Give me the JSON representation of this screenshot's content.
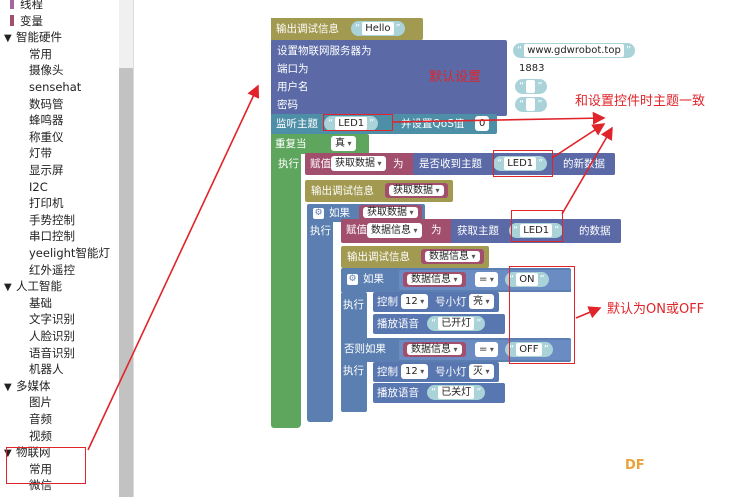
{
  "sidebar": {
    "items": [
      {
        "label": "线程",
        "kind": "sub",
        "color": "#a5659f"
      },
      {
        "label": "变量",
        "kind": "sub",
        "color": "#a24f6e"
      },
      {
        "label": "智能硬件",
        "kind": "cat"
      },
      {
        "label": "常用",
        "kind": "sub"
      },
      {
        "label": "摄像头",
        "kind": "sub"
      },
      {
        "label": "sensehat",
        "kind": "sub"
      },
      {
        "label": "数码管",
        "kind": "sub"
      },
      {
        "label": "蜂鸣器",
        "kind": "sub"
      },
      {
        "label": "称重仪",
        "kind": "sub"
      },
      {
        "label": "灯带",
        "kind": "sub"
      },
      {
        "label": "显示屏",
        "kind": "sub"
      },
      {
        "label": "I2C",
        "kind": "sub"
      },
      {
        "label": "打印机",
        "kind": "sub"
      },
      {
        "label": "手势控制",
        "kind": "sub"
      },
      {
        "label": "串口控制",
        "kind": "sub"
      },
      {
        "label": "yeelight智能灯",
        "kind": "sub"
      },
      {
        "label": "红外遥控",
        "kind": "sub"
      },
      {
        "label": "人工智能",
        "kind": "cat"
      },
      {
        "label": "基础",
        "kind": "sub"
      },
      {
        "label": "文字识别",
        "kind": "sub"
      },
      {
        "label": "人脸识别",
        "kind": "sub"
      },
      {
        "label": "语音识别",
        "kind": "sub"
      },
      {
        "label": "机器人",
        "kind": "sub"
      },
      {
        "label": "多媒体",
        "kind": "cat"
      },
      {
        "label": "图片",
        "kind": "sub"
      },
      {
        "label": "音频",
        "kind": "sub"
      },
      {
        "label": "视频",
        "kind": "sub"
      },
      {
        "label": "物联网",
        "kind": "cat"
      },
      {
        "label": "常用",
        "kind": "sub"
      },
      {
        "label": "微信",
        "kind": "sub"
      }
    ],
    "triangle": "▼"
  },
  "blocks": {
    "debug1_label": "输出调试信息",
    "debug1_value": "Hello",
    "server_label": "设置物联网服务器为",
    "server_value": "www.gdwrobot.top",
    "port_label": "端口为",
    "port_value": "1883",
    "user_label": "用户名",
    "pass_label": "密码",
    "quote_open": "“",
    "quote_close": "”",
    "subscribe_label": "监听主题",
    "subscribe_topic": "LED1",
    "qos_label": "并设置QoS值",
    "qos_value": "0",
    "repeat_label": "重复当",
    "repeat_cond": "真",
    "exec": "执行",
    "assign_label": "赋值",
    "var_get": "获取数据",
    "to_label": "为",
    "check_label": "是否收到主题",
    "check_topic": "LED1",
    "new_data_label": "的新数据",
    "debug2_label": "输出调试信息",
    "debug2_value": "获取数据",
    "if_label": "如果",
    "if_var": "获取数据",
    "assign2_label": "赋值",
    "var_msg": "数据信息",
    "to2_label": "为",
    "read_label": "获取主题",
    "read_topic": "LED1",
    "data_label": "的数据",
    "debug3_label": "输出调试信息",
    "debug3_value": "数据信息",
    "if2_label": "如果",
    "cmp_var": "数据信息",
    "cmp_op": "=",
    "cmp_on": "ON",
    "control_label": "控制",
    "lamp_num": "12",
    "lamp_label": "号小灯",
    "lamp_on": "亮",
    "speak_label": "播放语音",
    "speak_on": "已开灯",
    "elif_label": "否则如果",
    "cmp_var2": "数据信息",
    "cmp_op2": "=",
    "cmp_off": "OFF",
    "control2_label": "控制",
    "lamp_num2": "12",
    "lamp_label2": "号小灯",
    "lamp_off": "灭",
    "speak2_label": "播放语音",
    "speak_off": "已关灯"
  },
  "annotations": {
    "default_settings": "默认设置",
    "same_topic": "和设置控件时主题一致",
    "default_on_off": "默认为ON或OFF"
  },
  "watermark": "DF",
  "colors": {
    "annotation": "#e0242a",
    "watermark": "#e8a33a"
  }
}
